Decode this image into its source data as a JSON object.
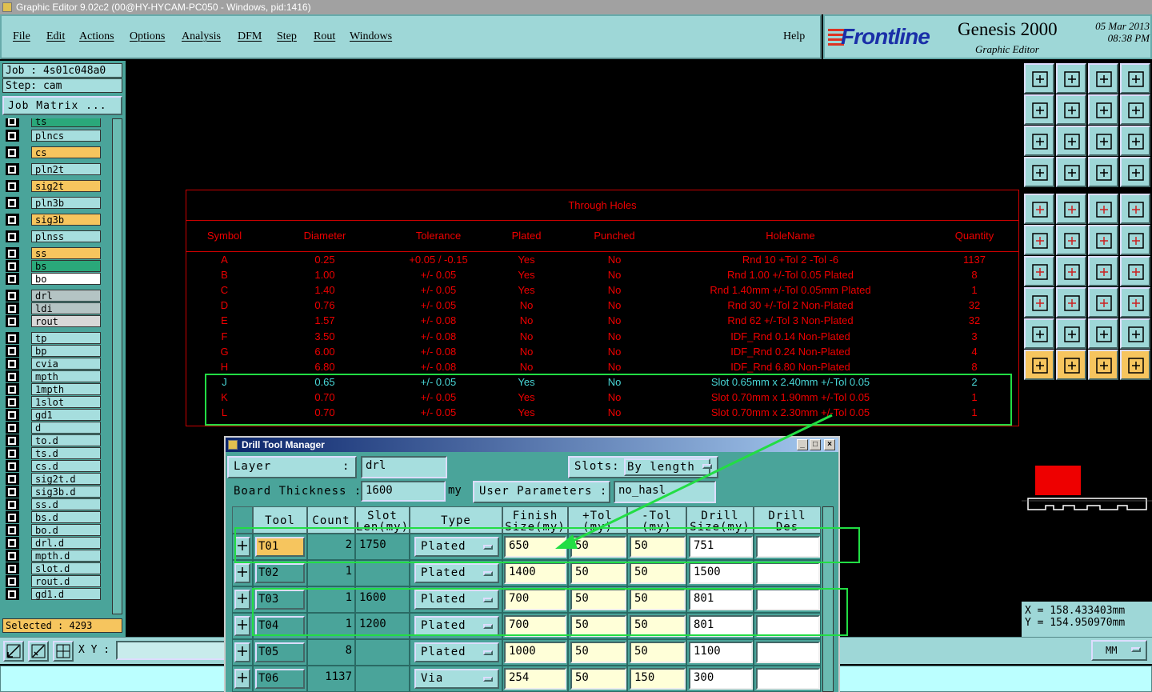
{
  "window": {
    "title": "Graphic Editor 9.02c2 (00@HY-HYCAM-PC050 - Windows, pid:1416)"
  },
  "menu": {
    "file": "File",
    "edit": "Edit",
    "actions": "Actions",
    "options": "Options",
    "analysis": "Analysis",
    "dfm": "DFM",
    "step": "Step",
    "rout": "Rout",
    "windows": "Windows",
    "help": "Help"
  },
  "brand": {
    "logo": "Frontline",
    "product": "Genesis 2000",
    "subtitle": "Graphic Editor",
    "date": "05 Mar 2013",
    "time": "08:38 PM"
  },
  "job": {
    "job_label": "Job : 4s01c048a0",
    "step_label": "Step: cam",
    "matrix_button": "Job Matrix ...",
    "selected": "Selected : 4293"
  },
  "layers": [
    {
      "name": "ts",
      "color": "#2aa87a"
    },
    {
      "name": "plncs",
      "color": "#a6dede"
    },
    {
      "name": "cs",
      "color": "#f6c55e"
    },
    {
      "name": "pln2t",
      "color": "#a6dede"
    },
    {
      "name": "sig2t",
      "color": "#f6c55e"
    },
    {
      "name": "pln3b",
      "color": "#a6dede"
    },
    {
      "name": "sig3b",
      "color": "#f6c55e"
    },
    {
      "name": "plnss",
      "color": "#a6dede"
    },
    {
      "name": "ss",
      "color": "#f6c55e"
    },
    {
      "name": "bs",
      "color": "#2aa87a"
    },
    {
      "name": "bo",
      "color": "#ffffff"
    },
    {
      "name": "drl",
      "color": "#b4c4c4"
    },
    {
      "name": "ldi",
      "color": "#b4c4c4"
    },
    {
      "name": "rout",
      "color": "#d8d8d8"
    },
    {
      "name": "tp",
      "color": "#a6dede"
    },
    {
      "name": "bp",
      "color": "#a6dede"
    },
    {
      "name": "cvia",
      "color": "#a6dede"
    },
    {
      "name": "mpth",
      "color": "#a6dede"
    },
    {
      "name": "1mpth",
      "color": "#a6dede"
    },
    {
      "name": "1slot",
      "color": "#a6dede"
    },
    {
      "name": "gd1",
      "color": "#a6dede"
    },
    {
      "name": "d",
      "color": "#a6dede"
    },
    {
      "name": "to.d",
      "color": "#a6dede"
    },
    {
      "name": "ts.d",
      "color": "#a6dede"
    },
    {
      "name": "cs.d",
      "color": "#a6dede"
    },
    {
      "name": "sig2t.d",
      "color": "#a6dede"
    },
    {
      "name": "sig3b.d",
      "color": "#a6dede"
    },
    {
      "name": "ss.d",
      "color": "#a6dede"
    },
    {
      "name": "bs.d",
      "color": "#a6dede"
    },
    {
      "name": "bo.d",
      "color": "#a6dede"
    },
    {
      "name": "drl.d",
      "color": "#a6dede"
    },
    {
      "name": "mpth.d",
      "color": "#a6dede"
    },
    {
      "name": "slot.d",
      "color": "#a6dede"
    },
    {
      "name": "rout.d",
      "color": "#a6dede"
    },
    {
      "name": "gd1.d",
      "color": "#a6dede"
    }
  ],
  "holes_table": {
    "title": "Through Holes",
    "headers": [
      "Symbol",
      "Diameter",
      "Tolerance",
      "Plated",
      "Punched",
      "HoleName",
      "Quantity"
    ],
    "rows": [
      [
        "A",
        "0.25",
        "+0.05 / -0.15",
        "Yes",
        "No",
        "Rnd 10 +Tol 2 -Tol -6",
        "1137"
      ],
      [
        "B",
        "1.00",
        "+/- 0.05",
        "Yes",
        "No",
        "Rnd 1.00 +/-Tol 0.05 Plated",
        "8"
      ],
      [
        "C",
        "1.40",
        "+/- 0.05",
        "Yes",
        "No",
        "Rnd 1.40mm +/-Tol 0.05mm Plated",
        "1"
      ],
      [
        "D",
        "0.76",
        "+/- 0.05",
        "No",
        "No",
        "Rnd 30 +/-Tol 2 Non-Plated",
        "32"
      ],
      [
        "E",
        "1.57",
        "+/- 0.08",
        "No",
        "No",
        "Rnd 62 +/-Tol 3 Non-Plated",
        "32"
      ],
      [
        "F",
        "3.50",
        "+/- 0.08",
        "No",
        "No",
        "IDF_Rnd 0.14 Non-Plated",
        "3"
      ],
      [
        "G",
        "6.00",
        "+/- 0.08",
        "No",
        "No",
        "IDF_Rnd 0.24 Non-Plated",
        "4"
      ],
      [
        "H",
        "6.80",
        "+/- 0.08",
        "No",
        "No",
        "IDF_Rnd 6.80 Non-Plated",
        "8"
      ],
      [
        "J",
        "0.65",
        "+/- 0.05",
        "Yes",
        "No",
        "Slot 0.65mm x 2.40mm +/-Tol 0.05",
        "2"
      ],
      [
        "K",
        "0.70",
        "+/- 0.05",
        "Yes",
        "No",
        "Slot 0.70mm x 1.90mm +/-Tol 0.05",
        "1"
      ],
      [
        "L",
        "0.70",
        "+/- 0.05",
        "Yes",
        "No",
        "Slot 0.70mm x 2.30mm +/-Tol 0.05",
        "1"
      ]
    ]
  },
  "coords": {
    "x": "X  =  158.433403mm",
    "y": "Y  =  154.950970mm"
  },
  "bottom": {
    "xy_label": "X Y :",
    "units": "MM"
  },
  "dtm": {
    "title": "Drill Tool Manager",
    "layer_label": "Layer",
    "layer_colon": ":",
    "layer_value": "drl",
    "slots_label": "Slots:",
    "slots_value": "By length",
    "thickness_label": "Board Thickness :",
    "thickness_value": "1600",
    "thickness_unit": "my",
    "user_params_label": "User Parameters :",
    "user_params_value": "no_hasl",
    "columns": {
      "tool": "Tool",
      "count": "Count",
      "slot1": "Slot",
      "slot2": "Len(my)",
      "type": "Type",
      "finish1": "Finish",
      "finish2": "Size(my)",
      "ptol1": "+Tol",
      "ptol2": "(my)",
      "mtol1": "-Tol",
      "mtol2": "(my)",
      "drill1": "Drill",
      "drill2": "Size(my)",
      "des1": "Drill",
      "des2": "Des"
    },
    "rows": [
      {
        "tool": "T01",
        "count": "2",
        "slot": "1750",
        "type": "Plated",
        "finish": "650",
        "ptol": "50",
        "mtol": "50",
        "drill": "751",
        "des": ""
      },
      {
        "tool": "T02",
        "count": "1",
        "slot": "",
        "type": "Plated",
        "finish": "1400",
        "ptol": "50",
        "mtol": "50",
        "drill": "1500",
        "des": ""
      },
      {
        "tool": "T03",
        "count": "1",
        "slot": "1600",
        "type": "Plated",
        "finish": "700",
        "ptol": "50",
        "mtol": "50",
        "drill": "801",
        "des": ""
      },
      {
        "tool": "T04",
        "count": "1",
        "slot": "1200",
        "type": "Plated",
        "finish": "700",
        "ptol": "50",
        "mtol": "50",
        "drill": "801",
        "des": ""
      },
      {
        "tool": "T05",
        "count": "8",
        "slot": "",
        "type": "Plated",
        "finish": "1000",
        "ptol": "50",
        "mtol": "50",
        "drill": "1100",
        "des": ""
      },
      {
        "tool": "T06",
        "count": "1137",
        "slot": "",
        "type": "Via",
        "finish": "254",
        "ptol": "50",
        "mtol": "150",
        "drill": "300",
        "des": ""
      }
    ]
  },
  "colors": {
    "accent_yellow": "#f6c55e",
    "panel": "#9ed7d7",
    "table_red": "#e00000",
    "highlight_cyan": "#49d6d6",
    "annotation_green": "#22dd44"
  }
}
